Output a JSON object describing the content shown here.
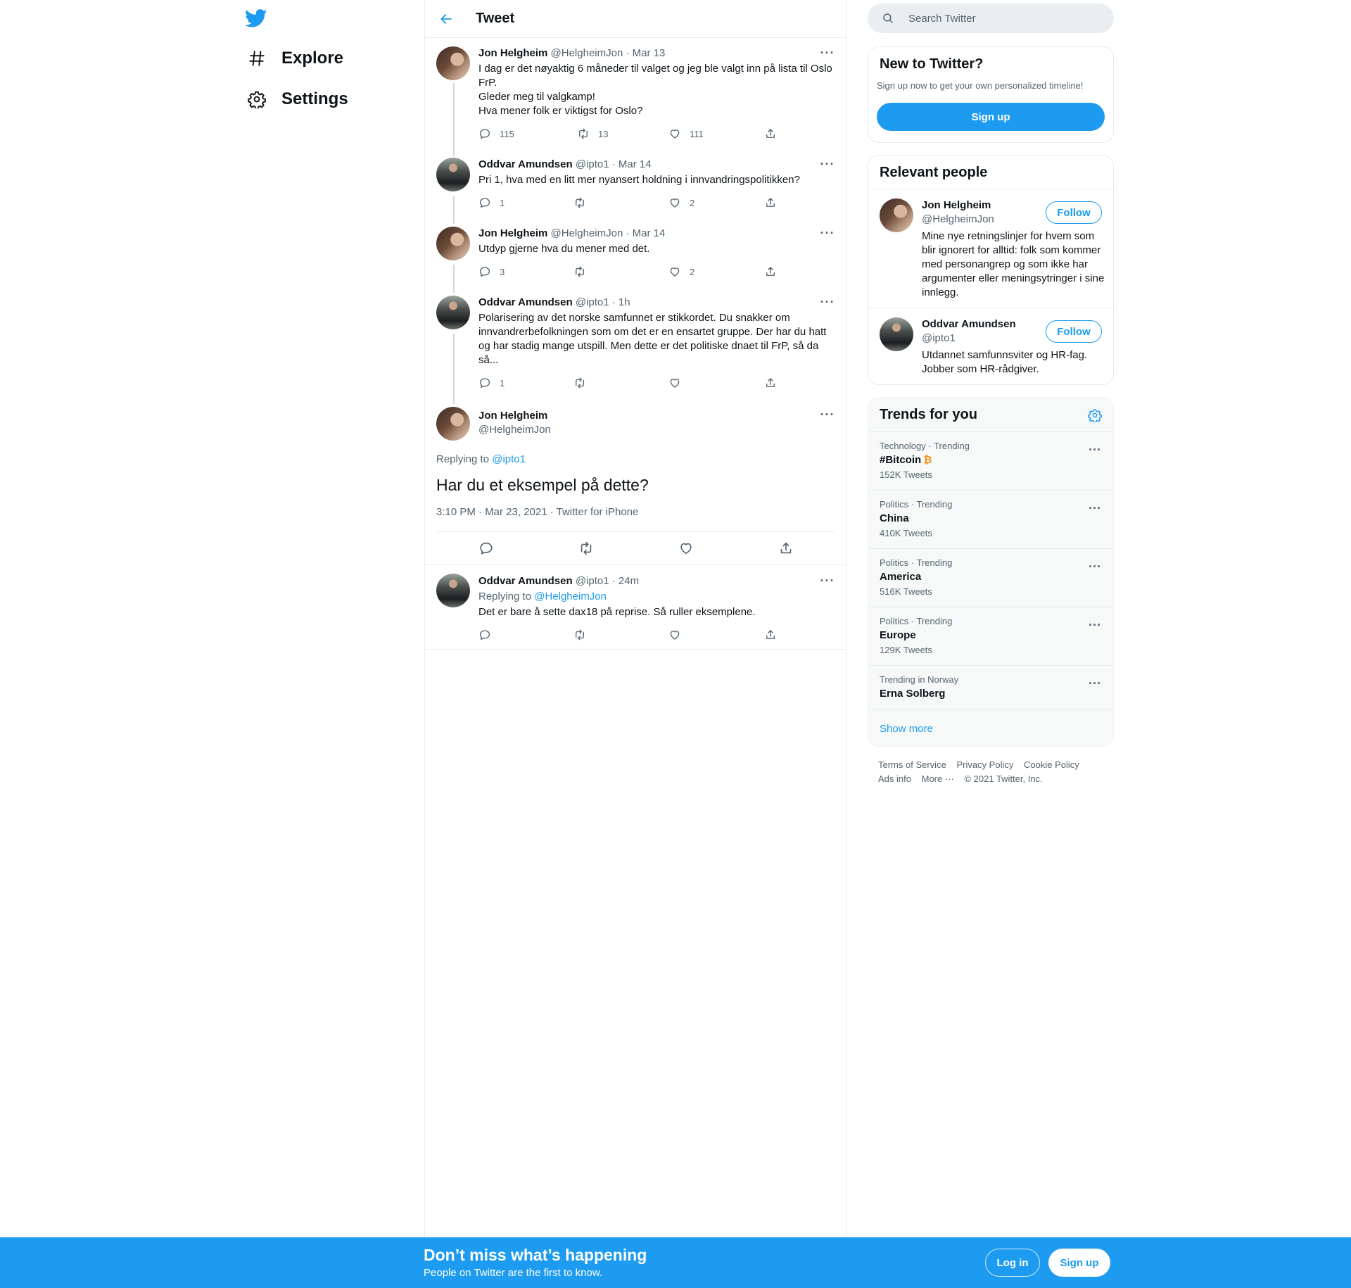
{
  "nav": {
    "items": [
      {
        "label": "Explore",
        "icon": "hashtag-icon"
      },
      {
        "label": "Settings",
        "icon": "gear-icon"
      }
    ]
  },
  "header": {
    "title": "Tweet"
  },
  "thread": [
    {
      "name": "Jon Helgheim",
      "handle": "@HelgheimJon",
      "date": "Mar 13",
      "text": "I dag er det nøyaktig 6 måneder til valget og jeg ble valgt inn på lista til Oslo FrP.\nGleder meg til valgkamp!\nHva mener folk er viktigst for Oslo?",
      "replies": "115",
      "retweets": "13",
      "likes": "111"
    },
    {
      "name": "Oddvar Amundsen",
      "handle": "@ipto1",
      "date": "Mar 14",
      "text": "Pri 1, hva med en litt mer nyansert holdning i innvandringspolitikken?",
      "replies": "1",
      "retweets": "",
      "likes": "2"
    },
    {
      "name": "Jon Helgheim",
      "handle": "@HelgheimJon",
      "date": "Mar 14",
      "text": "Utdyp gjerne hva du mener med det.",
      "replies": "3",
      "retweets": "",
      "likes": "2"
    },
    {
      "name": "Oddvar Amundsen",
      "handle": "@ipto1",
      "date": "1h",
      "text": "Polarisering av det norske samfunnet er stikkordet. Du snakker om innvandrerbefolkningen som om det er en ensartet gruppe. Der har du hatt og har stadig mange utspill. Men dette er det politiske dnaet til FrP, så da så...",
      "replies": "1",
      "retweets": "",
      "likes": ""
    }
  ],
  "focus": {
    "name": "Jon Helgheim",
    "handle": "@HelgheimJon",
    "replying_label": "Replying to",
    "replying_to": "@ipto1",
    "text": "Har du et eksempel på dette?",
    "timestamp": "3:10 PM · Mar 23, 2021 · Twitter for iPhone"
  },
  "reply": {
    "name": "Oddvar Amundsen",
    "handle": "@ipto1",
    "date": "24m",
    "replying_label": "Replying to",
    "replying_to": "@HelgheimJon",
    "text": "Det er bare å sette dax18 på reprise. Så ruller eksemplene."
  },
  "search": {
    "placeholder": "Search Twitter"
  },
  "new_to_twitter": {
    "title": "New to Twitter?",
    "subtitle": "Sign up now to get your own personalized timeline!",
    "signup": "Sign up"
  },
  "relevant_people": {
    "title": "Relevant people",
    "people": [
      {
        "name": "Jon Helgheim",
        "handle": "@HelgheimJon",
        "follow": "Follow",
        "bio": "Mine nye retningslinjer for hvem som blir ignorert for alltid: folk som kommer med personangrep og som ikke har argumenter eller meningsytringer i sine innlegg."
      },
      {
        "name": "Oddvar Amundsen",
        "handle": "@ipto1",
        "follow": "Follow",
        "bio": "Utdannet samfunnsviter og HR-fag. Jobber som HR-rådgiver."
      }
    ]
  },
  "trends": {
    "title": "Trends for you",
    "items": [
      {
        "meta": "Technology · Trending",
        "name": "#Bitcoin",
        "count": "152K Tweets"
      },
      {
        "meta": "Politics · Trending",
        "name": "China",
        "count": "410K Tweets"
      },
      {
        "meta": "Politics · Trending",
        "name": "America",
        "count": "516K Tweets"
      },
      {
        "meta": "Politics · Trending",
        "name": "Europe",
        "count": "129K Tweets"
      },
      {
        "meta": "Trending in Norway",
        "name": "Erna Solberg",
        "count": ""
      }
    ],
    "show_more": "Show more"
  },
  "footer": {
    "links": [
      "Terms of Service",
      "Privacy Policy",
      "Cookie Policy",
      "Ads info",
      "More ···",
      "© 2021 Twitter, Inc."
    ]
  },
  "banner": {
    "title": "Don’t miss what’s happening",
    "subtitle": "People on Twitter are the first to know.",
    "login": "Log in",
    "signup": "Sign up"
  },
  "colors": {
    "accent": "#1d9bf0",
    "text": "#0f1419",
    "muted": "#536471",
    "border": "#e6ecf0"
  }
}
